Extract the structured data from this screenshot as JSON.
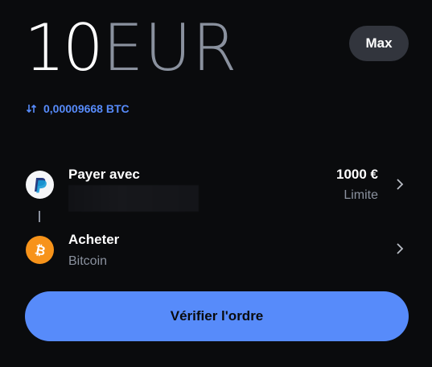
{
  "amount": {
    "value": "10",
    "currency": "EUR"
  },
  "max_button": {
    "label": "Max"
  },
  "conversion": {
    "text": "0,00009668 BTC"
  },
  "pay_with": {
    "title": "Payer avec",
    "limit_value": "1000 €",
    "limit_label": "Limite",
    "icon": "paypal-icon"
  },
  "buy": {
    "title": "Acheter",
    "asset": "Bitcoin",
    "icon": "bitcoin-icon"
  },
  "verify_button": {
    "label": "Vérifier l'ordre"
  },
  "colors": {
    "background": "#0a0b0d",
    "accent": "#578bfa",
    "muted": "#8a919e",
    "pill": "#32353d",
    "bitcoin": "#f7931a"
  }
}
